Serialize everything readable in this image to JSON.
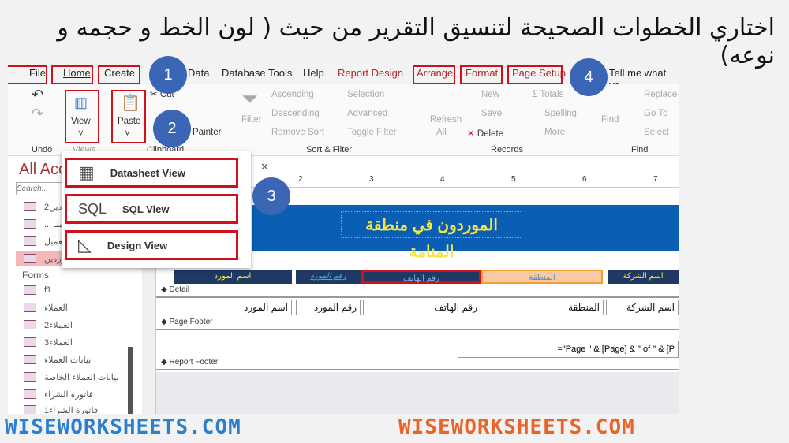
{
  "question": "اختاري الخطوات الصحيحة لتنسيق التقرير من حيث ( لون الخط و حجمه و نوعه)",
  "tabs": [
    "File",
    "Home",
    "Create",
    "Data",
    "Database Tools",
    "Help",
    "Report Design",
    "Arrange",
    "Format",
    "Page Setup",
    "Tell me what yo"
  ],
  "ribbon": {
    "undo": "Undo",
    "view": "View",
    "views": "Views",
    "paste": "Paste",
    "cut": "Cut",
    "painter": "Painter",
    "clipboard": "Clipboard",
    "filter": "Filter",
    "ascending": "Ascending",
    "descending": "Descending",
    "remove_sort": "Remove Sort",
    "selection": "Selection",
    "advanced": "Advanced",
    "toggle_filter": "Toggle Filter",
    "sort_filter": "Sort & Filter",
    "refresh": "Refresh",
    "all": "All",
    "new": "New",
    "save": "Save",
    "delete": "Delete",
    "totals": "Totals",
    "spelling": "Spelling",
    "more": "More",
    "records": "Records",
    "find": "Find",
    "replace": "Replace",
    "goto": "Go To",
    "select": "Select",
    "find_group": "Find"
  },
  "steps": [
    "1",
    "2",
    "3",
    "4"
  ],
  "nav": {
    "title": "All Acc",
    "search_placeholder": "Search...",
    "items": [
      "الموردين2",
      "... منـ..",
      "العميل",
      "الموردين"
    ],
    "forms_header": "Forms",
    "forms": [
      "f1",
      "العملاء",
      "العملاء2",
      "العملاء3",
      "بيانات العملاء",
      "بيانات العملاء الخاصة",
      "فاتورة الشراء",
      "فاتورة الشراء1"
    ]
  },
  "view_menu": [
    "Datasheet View",
    "SQL View",
    "Design View"
  ],
  "sql_glyph": "SQL",
  "design": {
    "ruler": [
      "2",
      "3",
      "4",
      "5",
      "6",
      "7"
    ],
    "report_title": "الموردون في منطقة المنامة",
    "headers": [
      "اسم المورد",
      "رقم المورد",
      "رقم الهاتف",
      "المنطقة",
      "اسم الشركة"
    ],
    "detail": "Detail",
    "fields": [
      "اسم المورد",
      "رقم المورد",
      "رقم الهاتف",
      "المنطقة",
      "اسم الشركة"
    ],
    "page_footer": "Page Footer",
    "page_expr": "=\"Page \" & [Page] & \" of \" & [P",
    "report_footer": "Report Footer"
  },
  "watermark": "WISEWORKSHEETS.COM",
  "colors": {
    "highlight": "#d0101a",
    "step": "#3a66b5",
    "report_header": "#0a5fb4",
    "title_text": "#f5e642"
  }
}
